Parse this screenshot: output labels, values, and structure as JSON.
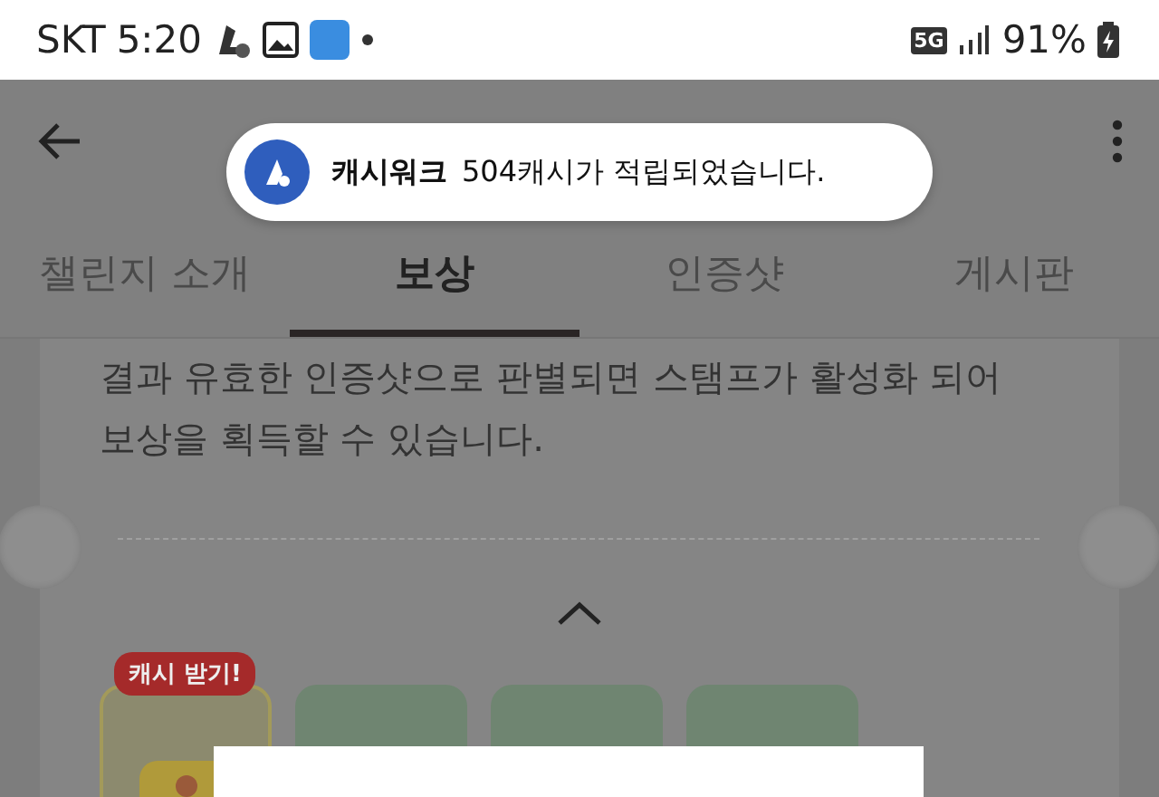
{
  "status_bar": {
    "carrier": "SKT",
    "time": "5:20",
    "network": "5G",
    "battery": "91%"
  },
  "toast": {
    "app": "캐시워크",
    "message": "504캐시가 적립되었습니다."
  },
  "tabs": [
    {
      "label": "챌린지 소개",
      "selected": false
    },
    {
      "label": "보상",
      "selected": true
    },
    {
      "label": "인증샷",
      "selected": false
    },
    {
      "label": "게시판",
      "selected": false
    }
  ],
  "description": "결과 유효한 인증샷으로 판별되면 스탬프가 활성화 되어 보상을 획득할 수 있습니다.",
  "stamps": [
    {
      "kind": "reward",
      "badge": "캐시 받기!"
    },
    {
      "kind": "stamp"
    },
    {
      "kind": "stamp"
    },
    {
      "kind": "stamp"
    }
  ]
}
